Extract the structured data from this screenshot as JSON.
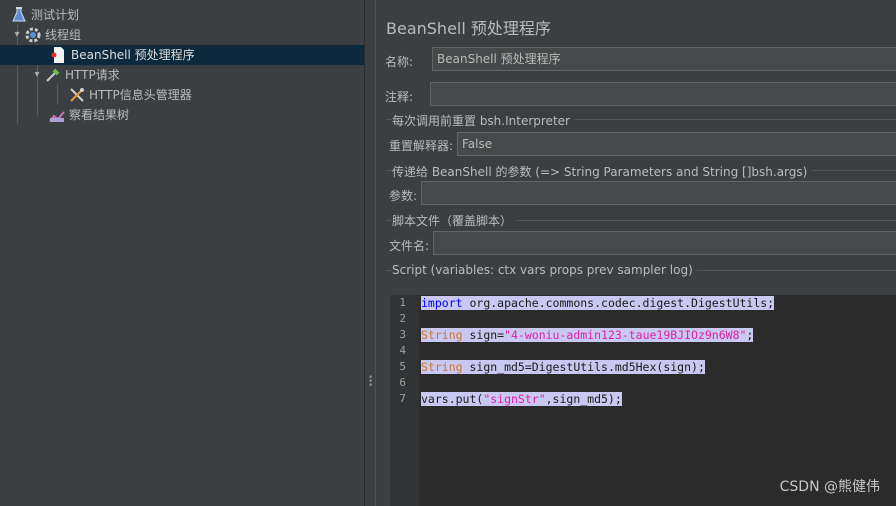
{
  "tree": {
    "items": [
      {
        "label": "测试计划",
        "icon": "flask-icon"
      },
      {
        "label": "线程组",
        "icon": "gear-icon"
      },
      {
        "label": "BeanShell 预处理程序",
        "icon": "document-icon"
      },
      {
        "label": "HTTP请求",
        "icon": "pipette-icon"
      },
      {
        "label": "HTTP信息头管理器",
        "icon": "tools-icon"
      },
      {
        "label": "察看结果树",
        "icon": "chart-icon"
      }
    ]
  },
  "panel": {
    "title": "BeanShell 预处理程序",
    "name_label": "名称:",
    "name_value": "BeanShell 预处理程序",
    "comment_label": "注释:",
    "comment_value": "",
    "reset_section": "每次调用前重置 bsh.Interpreter",
    "reset_label": "重置解释器:",
    "reset_value": "False",
    "params_section": "传递给 BeanShell 的参数 (=> String Parameters and String []bsh.args)",
    "params_label": "参数:",
    "params_value": "",
    "file_section": "脚本文件（覆盖脚本）",
    "file_label": "文件名:",
    "file_value": "",
    "script_section": "Script (variables: ctx vars props prev sampler log)"
  },
  "editor": {
    "line_numbers": [
      "1",
      "2",
      "3",
      "4",
      "5",
      "6",
      "7"
    ],
    "lines": {
      "l1_kw": "import",
      "l1_rest": " org.apache.commons.codec.digest.DigestUtils;",
      "l3_type": "String",
      "l3_mid": " sign=",
      "l3_str": "\"4-woniu-admin123-taue19BJIOz9n6W8\"",
      "l3_end": ";",
      "l5_type": "String",
      "l5_rest": " sign_md5=DigestUtils.md5Hex(sign);",
      "l7_a": "vars.put(",
      "l7_str": "\"signStr\"",
      "l7_b": ",sign_md5);"
    }
  },
  "watermark": "CSDN @熊健伟",
  "colors": {
    "background": "#3c3f41",
    "selection": "#0d293e",
    "editor_highlight": "#c8c8f0",
    "keyword": "#0000ff",
    "type": "#cc7832",
    "string": "#e020a8"
  }
}
